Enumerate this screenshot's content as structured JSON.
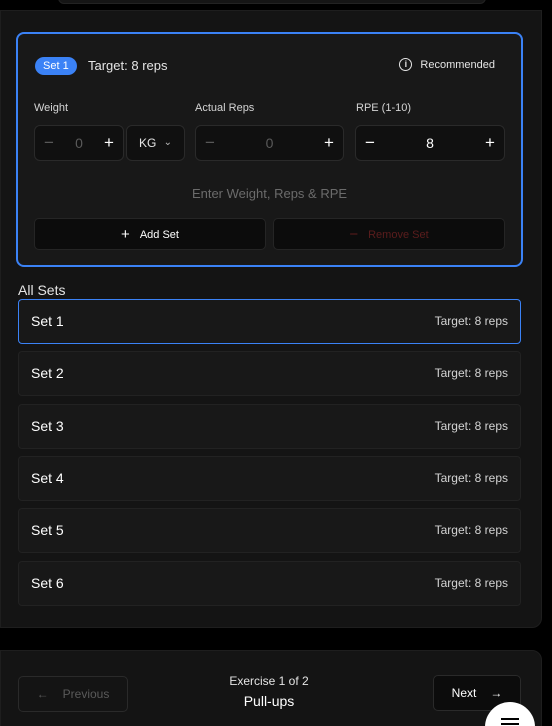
{
  "active_set": {
    "badge": "Set 1",
    "target": "Target: 8 reps",
    "recommended_label": "Recommended",
    "weight": {
      "label": "Weight",
      "value": "0",
      "unit": "KG"
    },
    "actual_reps": {
      "label": "Actual Reps",
      "value": "0"
    },
    "rpe": {
      "label": "RPE (1-10)",
      "value": "8"
    },
    "hint": "Enter Weight, Reps & RPE",
    "add_set_label": "Add Set",
    "remove_set_label": "Remove Set"
  },
  "all_sets": {
    "title": "All Sets",
    "rows": [
      {
        "name": "Set 1",
        "target": "Target: 8 reps"
      },
      {
        "name": "Set 2",
        "target": "Target: 8 reps"
      },
      {
        "name": "Set 3",
        "target": "Target: 8 reps"
      },
      {
        "name": "Set 4",
        "target": "Target: 8 reps"
      },
      {
        "name": "Set 5",
        "target": "Target: 8 reps"
      },
      {
        "name": "Set 6",
        "target": "Target: 8 reps"
      }
    ]
  },
  "footer": {
    "previous_label": "Previous",
    "next_label": "Next",
    "exercise_count": "Exercise 1 of 2",
    "exercise_name": "Pull-ups"
  },
  "icons": {
    "info": "info-icon",
    "plus": "plus-icon",
    "minus": "minus-icon",
    "chevron": "chevron-down-icon",
    "arrow_left": "arrow-left-icon",
    "arrow_right": "arrow-right-icon",
    "menu": "menu-icon"
  },
  "colors": {
    "accent": "#3b82f6",
    "danger_dim": "#5b1d1d",
    "background": "#000000",
    "card": "#141414"
  }
}
